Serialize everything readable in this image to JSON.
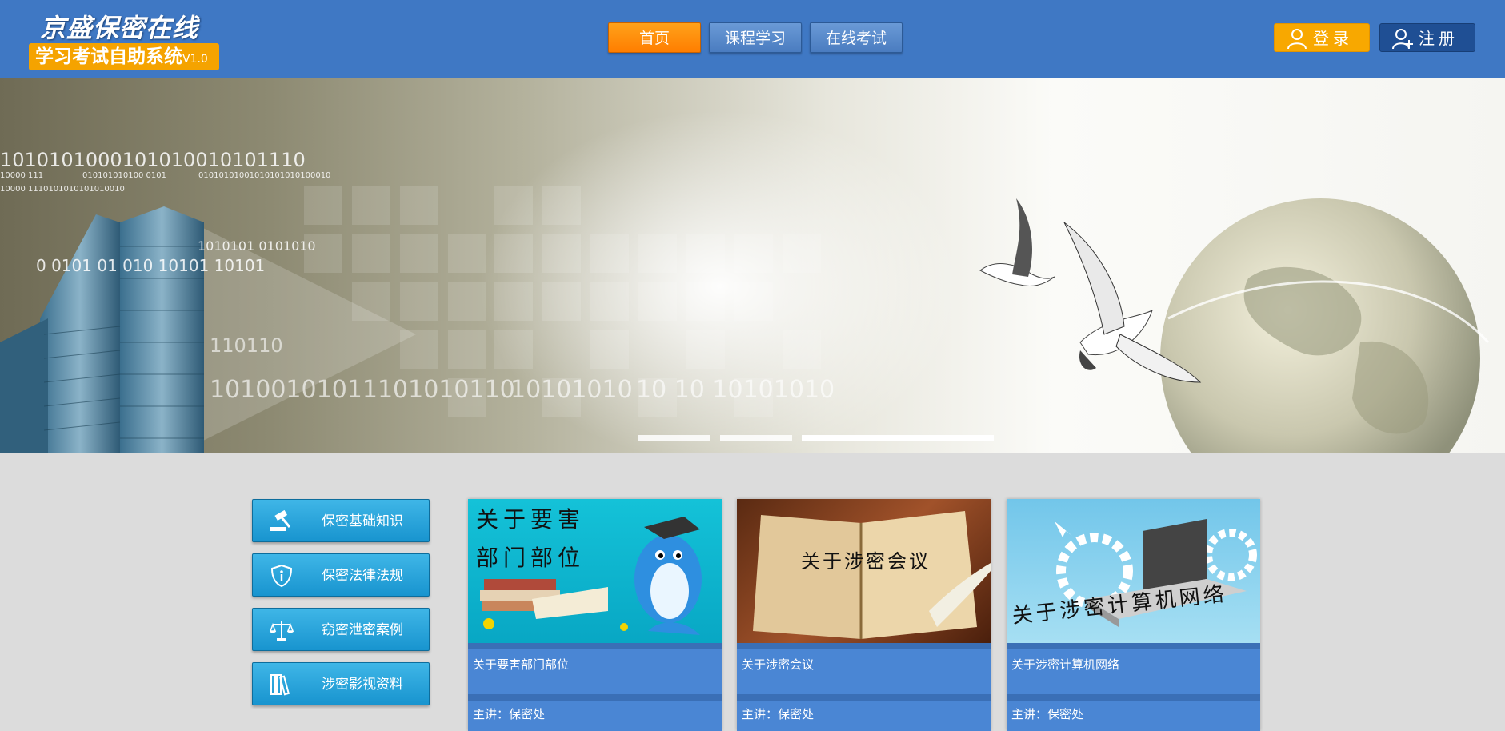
{
  "logo": {
    "title": "京盛保密在线",
    "subtitle": "学习考试自助系统",
    "version": "V1.0"
  },
  "nav": {
    "items": [
      "首页",
      "课程学习",
      "在线考试"
    ],
    "active": 0
  },
  "auth": {
    "login_label": "登录",
    "register_label": "注册"
  },
  "banner": {
    "binary_lines": [
      "1010101000101010010101110",
      "10000 111",
      "010101010100 0101",
      "01010101001010101010100010",
      "10000 1110101010101010010",
      "1010101 0101010",
      "0   0101  01 010 10101 10101",
      "110110",
      "10100101011101010110",
      "10101010",
      "10 10 10101010"
    ],
    "slide_count": 3,
    "active_slide": 2
  },
  "sidebar": {
    "items": [
      {
        "label": "保密基础知识",
        "icon": "gavel-icon"
      },
      {
        "label": "保密法律法规",
        "icon": "shield-info-icon"
      },
      {
        "label": "窃密泄密案例",
        "icon": "scales-icon"
      },
      {
        "label": "涉密影视资料",
        "icon": "books-icon"
      }
    ]
  },
  "cards": [
    {
      "title": "关于要害部门部位",
      "image_text": [
        "关于要害",
        "部门部位"
      ],
      "speaker": "主讲：保密处"
    },
    {
      "title": "关于涉密会议",
      "image_text": [
        "关于涉密会议"
      ],
      "speaker": "主讲：保密处"
    },
    {
      "title": "关于涉密计算机网络",
      "image_text": [
        "关于涉密计算机网络"
      ],
      "speaker": "主讲：保密处"
    }
  ],
  "colors": {
    "header": "#3f78c4",
    "accent": "#ff8a00",
    "sidebar": "#1f9ad3",
    "card": "#4a86d4",
    "background": "#dcdcdc"
  }
}
